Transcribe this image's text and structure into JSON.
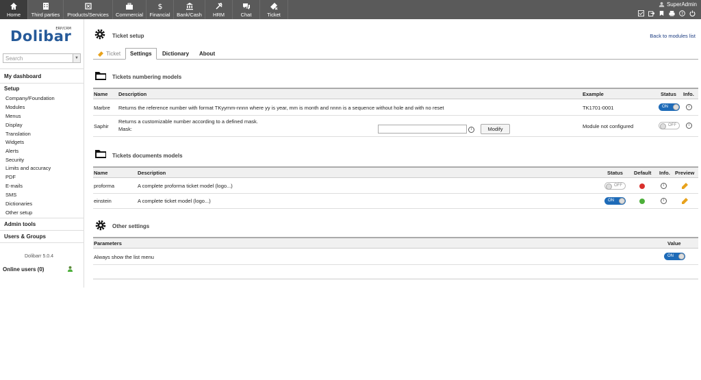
{
  "topmenu": [
    {
      "label": "Home",
      "icon": "home-icon",
      "active": true
    },
    {
      "label": "Third parties",
      "icon": "building-icon"
    },
    {
      "label": "Products/Services",
      "icon": "cube-icon"
    },
    {
      "label": "Commercial",
      "icon": "briefcase-icon"
    },
    {
      "label": "Financial",
      "icon": "dollar-icon"
    },
    {
      "label": "Bank/Cash",
      "icon": "bank-icon"
    },
    {
      "label": "HRM",
      "icon": "hrm-icon"
    },
    {
      "label": "Chat",
      "icon": "chat-icon"
    },
    {
      "label": "Ticket",
      "icon": "ticket-icon"
    }
  ],
  "user": {
    "name": "SuperAdmin"
  },
  "left": {
    "logo": "Dolibarr",
    "logo_sub": "ERP/CRM",
    "search_placeholder": "Search",
    "dashboard": "My dashboard",
    "setup": "Setup",
    "items": [
      "Company/Foundation",
      "Modules",
      "Menus",
      "Display",
      "Translation",
      "Widgets",
      "Alerts",
      "Security",
      "Limits and accuracy",
      "PDF",
      "E-mails",
      "SMS",
      "Dictionaries",
      "Other setup"
    ],
    "admin_tools": "Admin tools",
    "users_groups": "Users & Groups",
    "version": "Dolibarr 5.0.4",
    "online": "Online users (0)"
  },
  "page": {
    "title": "Ticket setup",
    "back": "Back to modules list",
    "tabs": [
      "Ticket",
      "Settings",
      "Dictionary",
      "About"
    ],
    "numbering": {
      "title": "Tickets numbering models",
      "headers": [
        "Name",
        "Description",
        "Example",
        "Status",
        "Info."
      ],
      "rows": [
        {
          "name": "Marbre",
          "desc": "Returns the reference number with format TKyymm-nnnn where yy is year, mm is month and nnnn is a sequence without hole and with no reset",
          "example": "TK1701-0001",
          "status": "ON"
        },
        {
          "name": "Saphir",
          "desc": "Returns a customizable number according to a defined mask.",
          "mask_label": "Mask:",
          "modify": "Modify",
          "example": "Module not configured",
          "status": "OFF"
        }
      ]
    },
    "documents": {
      "title": "Tickets documents models",
      "headers": [
        "Name",
        "Description",
        "Status",
        "Default",
        "Info.",
        "Preview"
      ],
      "rows": [
        {
          "name": "proforma",
          "desc": "A complete proforma ticket model (logo...)",
          "status": "OFF",
          "default_color": "#d9302c"
        },
        {
          "name": "einstein",
          "desc": "A complete ticket model (logo...)",
          "status": "ON",
          "default_color": "#4caf3a"
        }
      ]
    },
    "other": {
      "title": "Other settings",
      "headers": [
        "Parameters",
        "Value"
      ],
      "rows": [
        {
          "label": "Always show the list menu",
          "status": "ON"
        }
      ]
    }
  }
}
